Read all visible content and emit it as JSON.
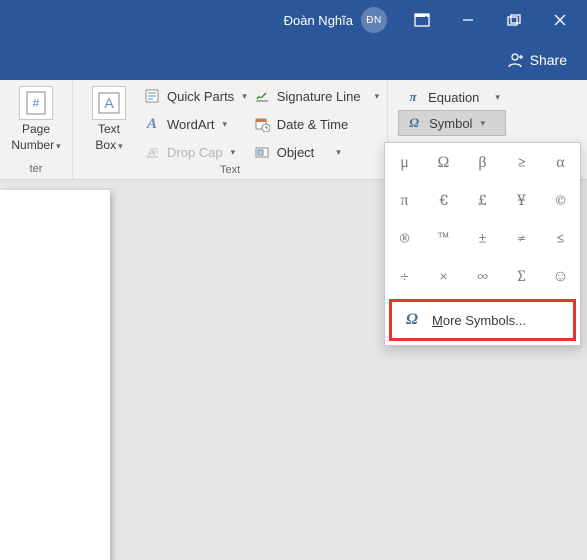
{
  "titlebar": {
    "username": "Đoàn Nghĩa",
    "initials": "ĐN"
  },
  "sharebar": {
    "share_label": "Share"
  },
  "ribbon": {
    "page_number": {
      "line1": "Page",
      "line2": "Number"
    },
    "page_number_group_caption": "ter",
    "text_box": {
      "line1": "Text",
      "line2": "Box"
    },
    "text_group_label": "Text",
    "cmds": {
      "quick_parts": "Quick Parts",
      "wordart": "WordArt",
      "drop_cap": "Drop Cap",
      "signature_line": "Signature Line",
      "date_time": "Date & Time",
      "object": "Object"
    },
    "symbols": {
      "equation": "Equation",
      "symbol": "Symbol"
    }
  },
  "dropdown": {
    "grid": [
      "μ",
      "Ω",
      "β",
      "≥",
      "α",
      "π",
      "€",
      "£",
      "¥",
      "©",
      "®",
      "™",
      "±",
      "≠",
      "≤",
      "÷",
      "×",
      "∞",
      "∑",
      "☺"
    ],
    "more_prefix": "M",
    "more_rest": "ore Symbols..."
  }
}
